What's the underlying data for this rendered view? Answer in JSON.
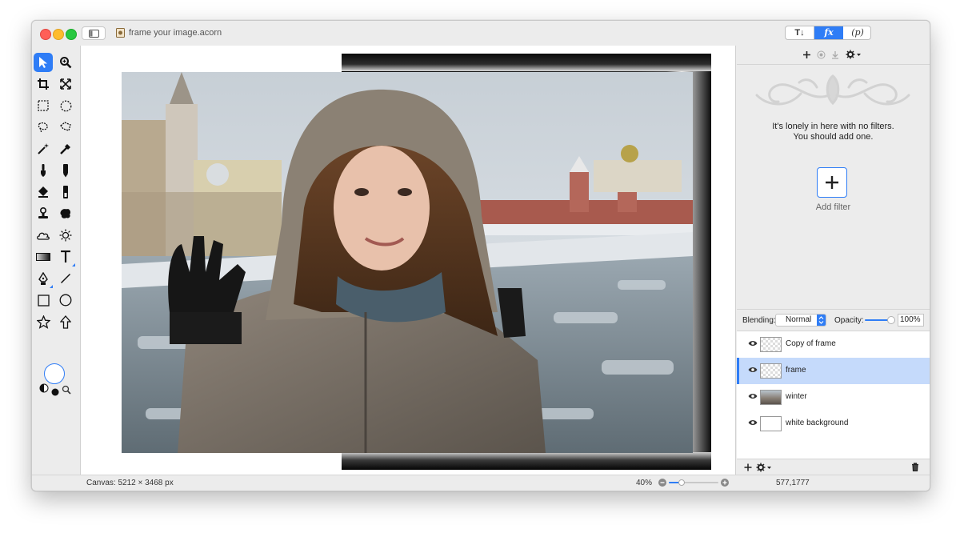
{
  "window": {
    "title": "frame your image.acorn",
    "mode_tabs": [
      "T↓",
      "fx",
      "(p)"
    ],
    "active_tab": "fx"
  },
  "filters": {
    "empty_line1": "It's lonely in here with no filters.",
    "empty_line2": "You should add one.",
    "add_filter_label": "Add filter"
  },
  "blend": {
    "label": "Blending:",
    "mode": "Normal",
    "opacity_label": "Opacity:",
    "opacity_value": "100%",
    "opacity_level": 1.0
  },
  "layers": [
    {
      "name": "Copy of frame",
      "thumb": "checker",
      "selected": false
    },
    {
      "name": "frame",
      "thumb": "checker",
      "selected": true
    },
    {
      "name": "winter",
      "thumb": "photo",
      "selected": false
    },
    {
      "name": "white background",
      "thumb": "white",
      "selected": false
    }
  ],
  "status": {
    "canvas": "Canvas: 5212 × 3468 px",
    "zoom": "40%",
    "coords": "577,1777"
  },
  "colors": {
    "accent": "#2f7df6",
    "selection_row": "#c5dafb",
    "frame": "#000000"
  },
  "tools": [
    "move-tool-icon",
    "zoom-tool-icon",
    "crop-tool-icon",
    "transform-tool-icon",
    "rect-select-icon",
    "ellipse-select-icon",
    "lasso-icon",
    "polygon-lasso-icon",
    "magic-wand-icon",
    "color-select-icon",
    "brush-icon",
    "pencil-icon",
    "paint-bucket-icon",
    "eraser-icon",
    "clone-stamp-icon",
    "smudge-icon",
    "cloud-icon",
    "sun-icon",
    "gradient-icon",
    "text-tool-icon",
    "pen-tool-icon",
    "line-tool-icon",
    "rectangle-shape-icon",
    "oval-shape-icon",
    "star-shape-icon",
    "arrow-shape-icon"
  ]
}
